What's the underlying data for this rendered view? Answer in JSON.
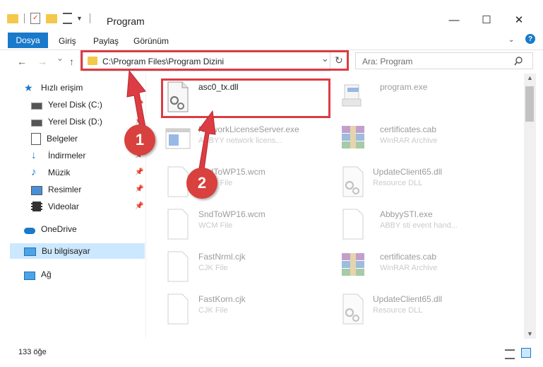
{
  "window": {
    "title": "Program",
    "minimize": "—",
    "maximize": "☐",
    "close": "✕"
  },
  "ribbon": {
    "tabs": [
      "Dosya",
      "Giriş",
      "Paylaş",
      "Görünüm"
    ],
    "help": "?"
  },
  "nav": {
    "back": "←",
    "forward": "→",
    "recent": "⌄",
    "up": "↑",
    "address": "C:\\Program Files\\Program Dizini",
    "dropdown": "⌄",
    "refresh": "↻",
    "search_placeholder": "Ara: Program"
  },
  "sidebar": {
    "items": [
      {
        "label": "Hızlı erişim",
        "icon": "star-icon",
        "pinned": false
      },
      {
        "label": "Yerel Disk (C:)",
        "icon": "drive-icon",
        "pinned": true
      },
      {
        "label": "Yerel Disk (D:)",
        "icon": "drive-icon",
        "pinned": true
      },
      {
        "label": "Belgeler",
        "icon": "documents-icon",
        "pinned": true
      },
      {
        "label": "İndirmeler",
        "icon": "download-icon",
        "pinned": true
      },
      {
        "label": "Müzik",
        "icon": "music-icon",
        "pinned": true
      },
      {
        "label": "Resimler",
        "icon": "pictures-icon",
        "pinned": true
      },
      {
        "label": "Videolar",
        "icon": "video-icon",
        "pinned": true
      },
      {
        "label": "OneDrive",
        "icon": "cloud-icon",
        "pinned": false
      },
      {
        "label": "Bu bilgisayar",
        "icon": "computer-icon",
        "pinned": false,
        "selected": true
      },
      {
        "label": "Ağ",
        "icon": "network-icon",
        "pinned": false
      }
    ]
  },
  "files": {
    "left": [
      {
        "name": "asc0_tx.dll",
        "type": "",
        "icon": "dll-gear-icon",
        "highlight": true
      },
      {
        "name": "NetworkLicenseServer.exe",
        "type": "ABBYY network licens...",
        "icon": "exe-window-icon"
      },
      {
        "name": "SndToWP15.wcm",
        "type": "WCM File",
        "icon": "blank-file-icon"
      },
      {
        "name": "SndToWP16.wcm",
        "type": "WCM File",
        "icon": "blank-file-icon"
      },
      {
        "name": "FastNrml.cjk",
        "type": "CJK File",
        "icon": "blank-file-icon"
      },
      {
        "name": "FastKorn.cjk",
        "type": "CJK File",
        "icon": "blank-file-icon"
      }
    ],
    "right": [
      {
        "name": "program.exe",
        "type": "",
        "icon": "installer-icon"
      },
      {
        "name": "certificates.cab",
        "type": "WinRAR Archive",
        "icon": "winrar-icon"
      },
      {
        "name": "UpdateClient65.dll",
        "type": "Resource DLL",
        "icon": "dll-gear-icon"
      },
      {
        "name": "AbbyySTI.exe",
        "type": "ABBY sti event hand...",
        "icon": "blank-file-icon"
      },
      {
        "name": "certificates.cab",
        "type": "WinRAR Archive",
        "icon": "winrar-icon"
      },
      {
        "name": "UpdateClient65.dll",
        "type": "Resource DLL",
        "icon": "dll-gear-icon"
      }
    ]
  },
  "annotations": {
    "step1": "1",
    "step2": "2"
  },
  "status": {
    "count": "133 öğe"
  },
  "colors": {
    "accent": "#1979ca",
    "highlight": "#dc3c43",
    "selected": "#cce8ff"
  }
}
